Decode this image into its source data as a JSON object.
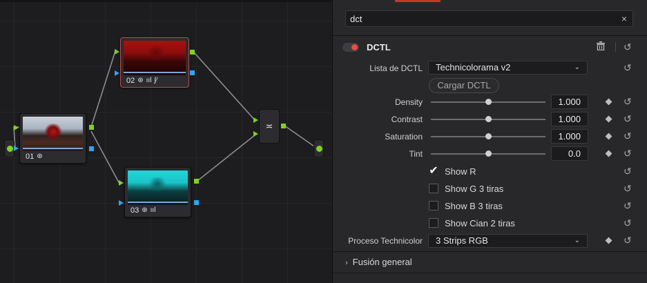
{
  "node_editor": {
    "nodes": [
      {
        "number": "01",
        "tools": [
          "⊛"
        ]
      },
      {
        "number": "02",
        "tools": [
          "⊛",
          "ııl",
          "∫∕"
        ]
      },
      {
        "number": "03",
        "tools": [
          "⊛",
          "ııl"
        ]
      }
    ],
    "mixer_icon": "≍"
  },
  "inspector": {
    "search": {
      "value": "dct",
      "clear_icon": "×"
    },
    "section": {
      "title": "DCTL",
      "enabled": true,
      "toggle_color": "#e5503f"
    },
    "dctl_list": {
      "label": "Lista de DCTL",
      "selected": "Technicolorama v2"
    },
    "load_button": "Cargar DCTL",
    "sliders": [
      {
        "label": "Density",
        "value": "1.000",
        "position": 0.5
      },
      {
        "label": "Contrast",
        "value": "1.000",
        "position": 0.5
      },
      {
        "label": "Saturation",
        "value": "1.000",
        "position": 0.5
      },
      {
        "label": "Tint",
        "value": "0.0",
        "position": 0.5
      }
    ],
    "checkboxes": [
      {
        "label": "Show R",
        "checked": true
      },
      {
        "label": "Show G 3 tiras",
        "checked": false
      },
      {
        "label": "Show B 3 tiras",
        "checked": false
      },
      {
        "label": "Show Cian 2 tiras",
        "checked": false
      }
    ],
    "process": {
      "label": "Proceso Technicolor",
      "selected": "3 Strips RGB"
    },
    "collapsed_section": "Fusión general",
    "icons": {
      "reset": "↺",
      "trash": "🗑",
      "chevron_down": "⌄",
      "chevron_right": "›",
      "check": "✔"
    },
    "accent_color": "#c0392b"
  }
}
